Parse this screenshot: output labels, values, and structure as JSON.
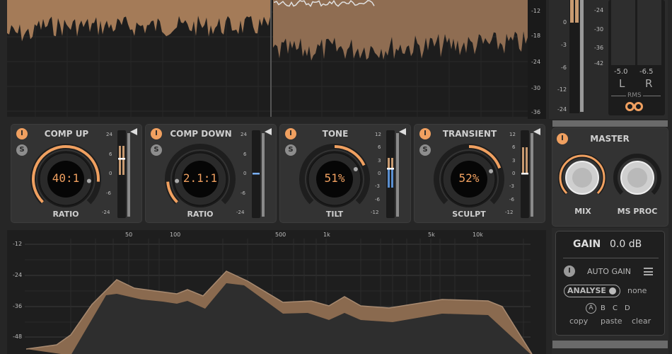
{
  "colors": {
    "accent": "#f0a060",
    "blue": "#5a8fd0",
    "band": "#8a6a4f",
    "panel": "#333333"
  },
  "spectrum_scale": [
    "-12",
    "-18",
    "-24",
    "-30",
    "-36"
  ],
  "output_meter_scale": [
    "0",
    "-3",
    "-6",
    "-12",
    "-24"
  ],
  "rms_meter": {
    "scale": [
      "-24",
      "-30",
      "-36",
      "-42"
    ],
    "left_value": "-5.0",
    "right_value": "-6.5",
    "left_label": "L",
    "right_label": "R",
    "mode_label": "RMS",
    "link_icon": "link-rings-icon"
  },
  "modules": [
    {
      "title": "COMP UP",
      "value": "40:1",
      "param": "RATIO",
      "power": "I",
      "solo": "S",
      "arc": [
        0,
        0.85
      ],
      "scale": [
        "24",
        "6",
        "0",
        "-6",
        "-24"
      ]
    },
    {
      "title": "COMP DOWN",
      "value": "2.1:1",
      "param": "RATIO",
      "power": "I",
      "solo": "S",
      "arc": [
        0,
        0.15
      ],
      "scale": [
        "24",
        "6",
        "0",
        "-6",
        "-24"
      ]
    },
    {
      "title": "TONE",
      "value": "51%",
      "param": "TILT",
      "power": "I",
      "solo": "S",
      "arc": [
        0.5,
        0.74
      ],
      "scale": [
        "12",
        "6",
        "3",
        "0",
        "-3",
        "-6",
        "-12"
      ]
    },
    {
      "title": "TRANSIENT",
      "value": "52%",
      "param": "SCULPT",
      "power": "I",
      "solo": "S",
      "arc": [
        0.5,
        0.76
      ],
      "scale": [
        "12",
        "6",
        "3",
        "0",
        "-3",
        "-6",
        "-12"
      ]
    }
  ],
  "master": {
    "title": "MASTER",
    "power": "I",
    "knobs": [
      {
        "label": "MIX",
        "arc": [
          0,
          1
        ]
      },
      {
        "label": "MS PROC",
        "arc": [
          0.5,
          0.5
        ]
      }
    ]
  },
  "eq": {
    "freq_labels": [
      "50",
      "100",
      "500",
      "1k",
      "5k",
      "10k"
    ],
    "db_labels": [
      "-12",
      "-24",
      "-36",
      "-48"
    ]
  },
  "gain": {
    "label": "GAIN",
    "value": "0.0 dB",
    "power": "I",
    "auto_gain": "AUTO GAIN",
    "analyse": "ANALYSE",
    "analyse_state": "none",
    "slots": [
      "A",
      "B",
      "C",
      "D"
    ],
    "active_slot": "A",
    "copy": "copy",
    "paste": "paste",
    "clear": "clear"
  }
}
